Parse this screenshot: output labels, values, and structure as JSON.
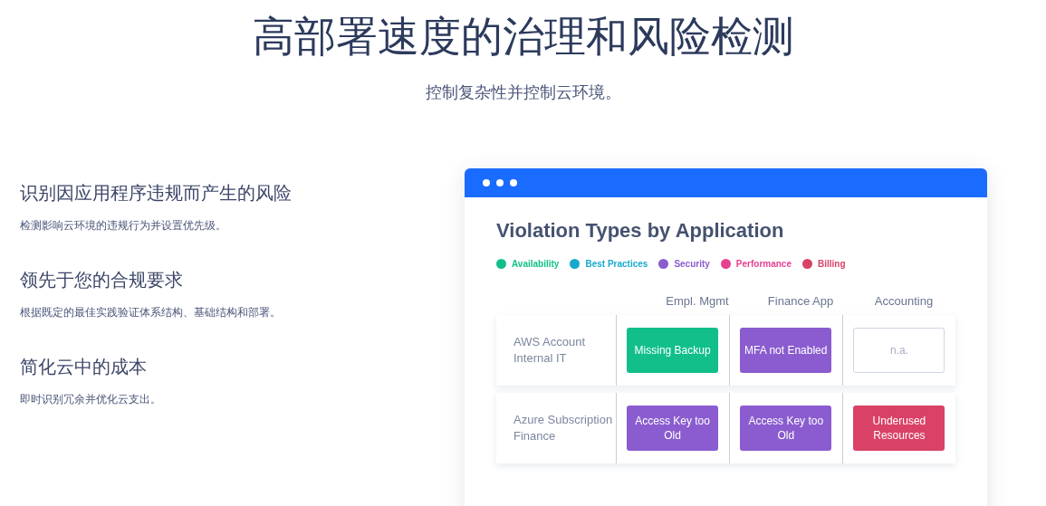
{
  "hero": {
    "title": "高部署速度的治理和风险检测",
    "subtitle": "控制复杂性并控制云环境。"
  },
  "features": [
    {
      "heading": "识别因应用程序违规而产生的风险",
      "description": "检测影响云环境的违规行为并设置优先级。"
    },
    {
      "heading": "领先于您的合规要求",
      "description": "根据既定的最佳实践验证体系结构、基础结构和部署。"
    },
    {
      "heading": "简化云中的成本",
      "description": "即时识别冗余并优化云支出。"
    }
  ],
  "card": {
    "title": "Violation Types by Application",
    "legend": [
      {
        "label": "Availability",
        "color": "#12bf8a"
      },
      {
        "label": "Best Practices",
        "color": "#17a9cc"
      },
      {
        "label": "Security",
        "color": "#8a5ccf"
      },
      {
        "label": "Performance",
        "color": "#e6418f"
      },
      {
        "label": "Billing",
        "color": "#d94266"
      }
    ],
    "columns": [
      "Empl. Mgmt",
      "Finance App",
      "Accounting"
    ],
    "rows": [
      {
        "label": "AWS Account Internal IT",
        "cells": [
          {
            "kind": "violation",
            "text": "Missing Backup",
            "color": "#12bf8a"
          },
          {
            "kind": "violation",
            "text": "MFA not Enabled",
            "color": "#8a5ccf"
          },
          {
            "kind": "empty",
            "text": "n.a."
          }
        ]
      },
      {
        "label": "Azure Subscription Finance",
        "cells": [
          {
            "kind": "violation",
            "text": "Access Key too Old",
            "color": "#8a5ccf"
          },
          {
            "kind": "violation",
            "text": "Access Key too Old",
            "color": "#8a5ccf"
          },
          {
            "kind": "violation",
            "text": "Underused Resources",
            "color": "#d94266"
          }
        ]
      }
    ]
  }
}
